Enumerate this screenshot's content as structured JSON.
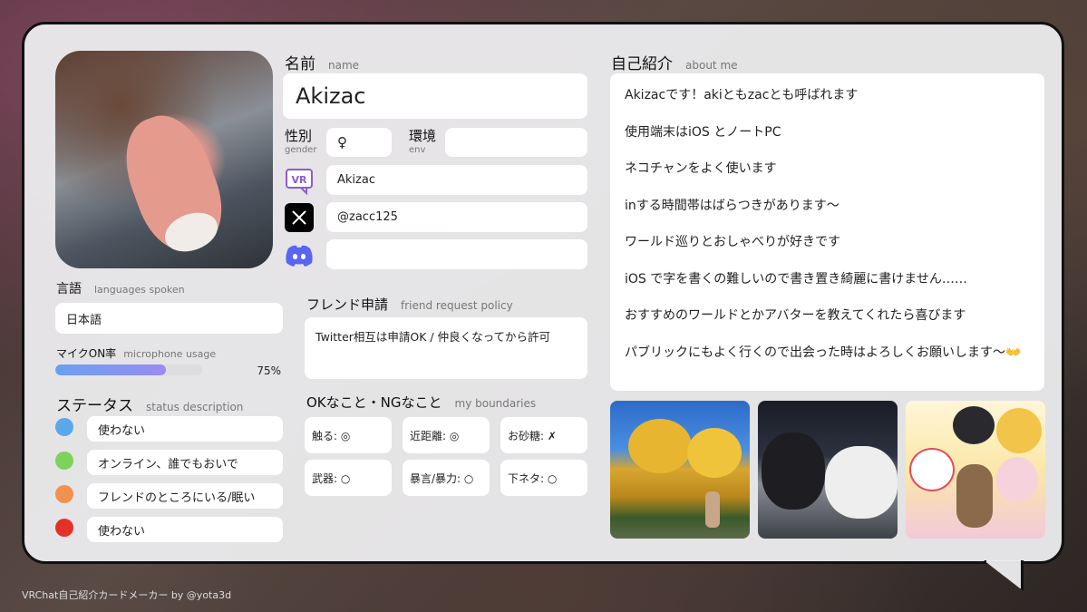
{
  "name": {
    "label": "名前",
    "sub": "name",
    "value": "Akizac"
  },
  "gender": {
    "label": "性別",
    "sub": "gender",
    "value": "♀"
  },
  "env": {
    "label": "環境",
    "sub": "env",
    "value": ""
  },
  "socials": {
    "vrchat": "Akizac",
    "x": "@zacc125",
    "discord": ""
  },
  "languages": {
    "label": "言語",
    "sub": "languages spoken",
    "value": "日本語"
  },
  "mic": {
    "label": "マイクON率",
    "sub": "microphone usage",
    "value_text": "75%",
    "value": 0.75
  },
  "status": {
    "label": "ステータス",
    "sub": "status description",
    "items": [
      {
        "color": "#5aa8ec",
        "text": "使わない"
      },
      {
        "color": "#7bd35a",
        "text": "オンライン、誰でもおいで"
      },
      {
        "color": "#f0914e",
        "text": "フレンドのところにいる/眠い"
      },
      {
        "color": "#e5302a",
        "text": "使わない"
      }
    ]
  },
  "friend": {
    "label": "フレンド申請",
    "sub": "friend request policy",
    "value": "Twitter相互は申請OK / 仲良くなってから許可"
  },
  "boundaries": {
    "label": "OKなこと・NGなこと",
    "sub": "my boundaries",
    "items": [
      "触る: ◎",
      "近距離: ◎",
      "お砂糖: ✗",
      "武器: ○",
      "暴言/暴力: ○",
      "下ネタ: ○"
    ]
  },
  "about": {
    "label": "自己紹介",
    "sub": "about me",
    "lines": [
      "Akizacです！akiともzacとも呼ばれます",
      "使用端末はiOS とノートPC",
      "ネコチャンをよく使います",
      "inする時間帯はばらつきがあります〜",
      "ワールド巡りとおしゃべりが好きです",
      "iOS で字を書くの難しいので書き置き綺麗に書けません……",
      "おすすめのワールドとかアバターを教えてくれたら喜びます",
      "パブリックにもよく行くので出会った時はよろしくお願いします〜👐"
    ]
  },
  "footer": "VRChat自己紹介カードメーカー by @yota3d",
  "colors": {
    "accent": "#8c5cd6",
    "discord": "#5865f2"
  }
}
